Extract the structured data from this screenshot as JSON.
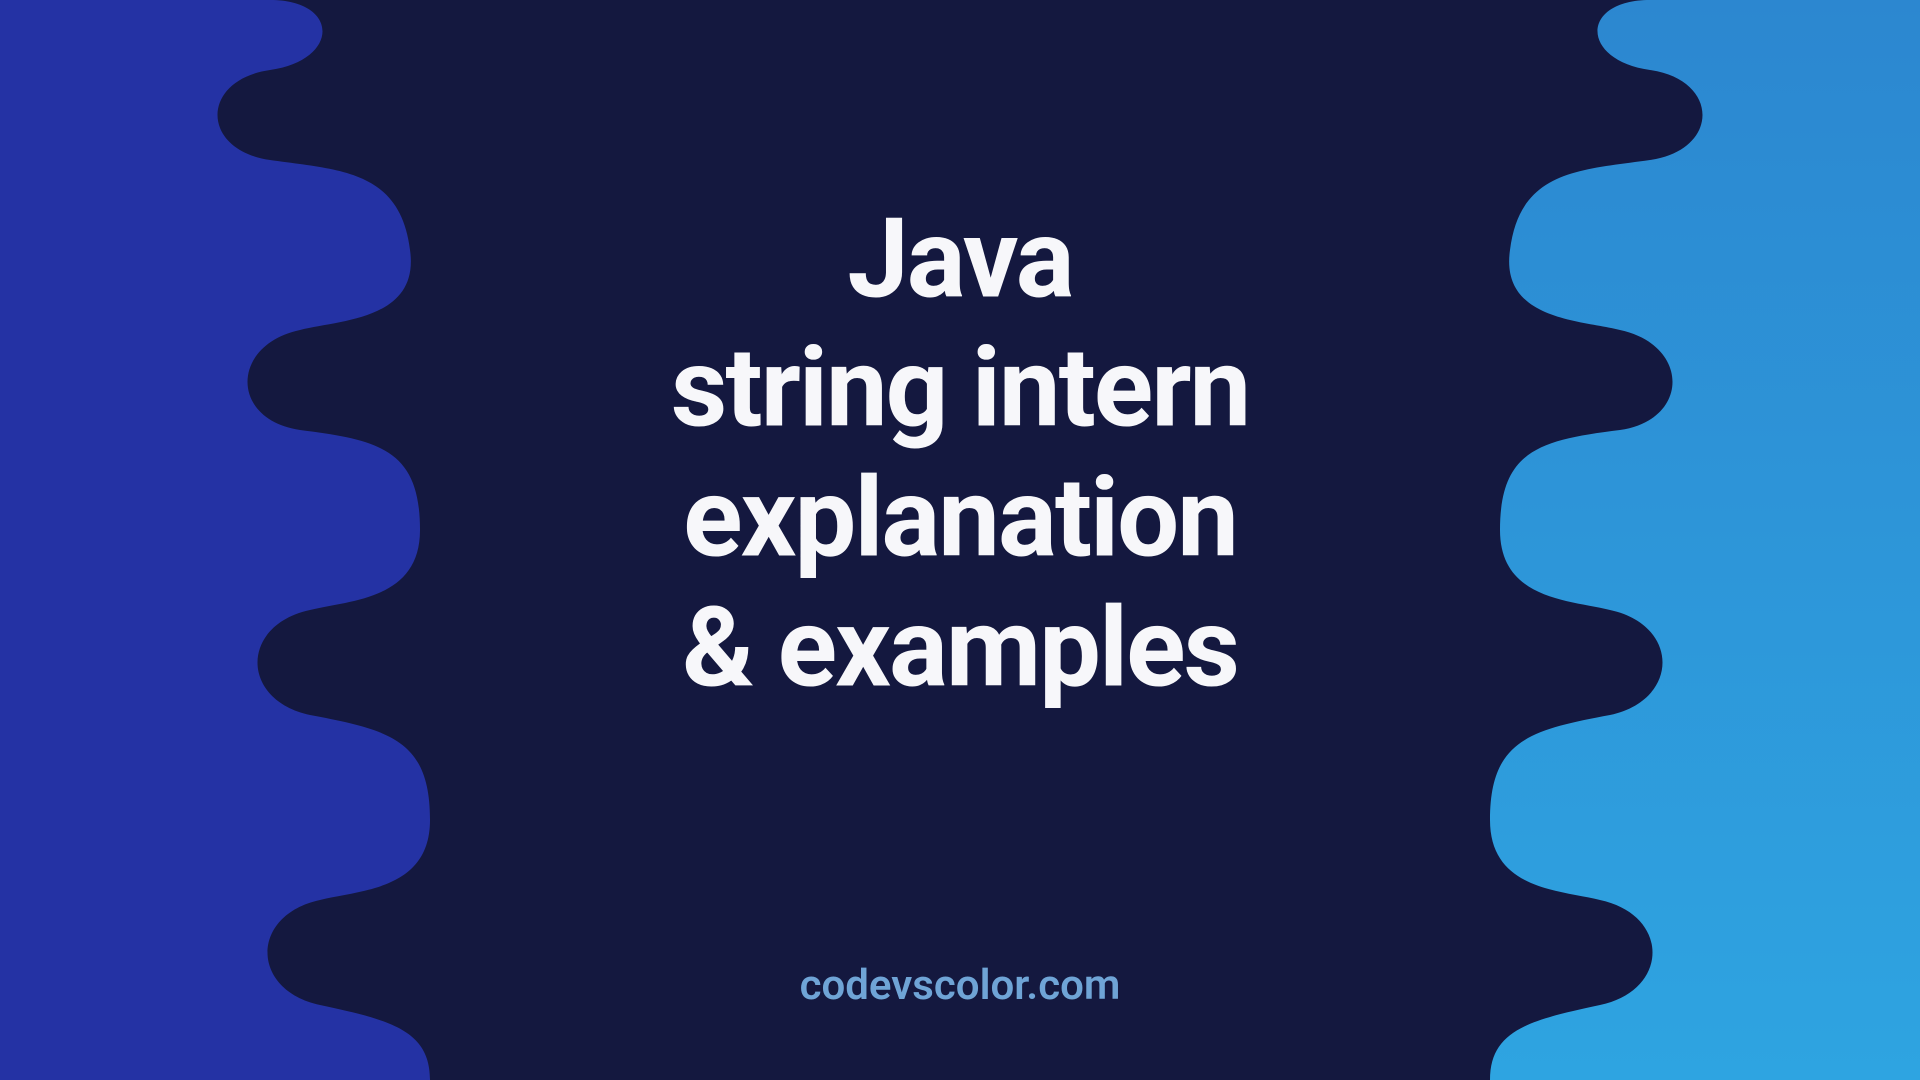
{
  "title": {
    "line1": "Java",
    "line2": "string intern",
    "line3": "explanation",
    "line4": "& examples"
  },
  "site_label": "codevscolor.com",
  "colors": {
    "bg_center": "#14183f",
    "left_panel": "#2432a4",
    "right_panel_top": "#2c87d0",
    "right_panel_bottom": "#2ea4e1",
    "text": "#f7f7fa",
    "site_text": "#6fa4d6"
  }
}
